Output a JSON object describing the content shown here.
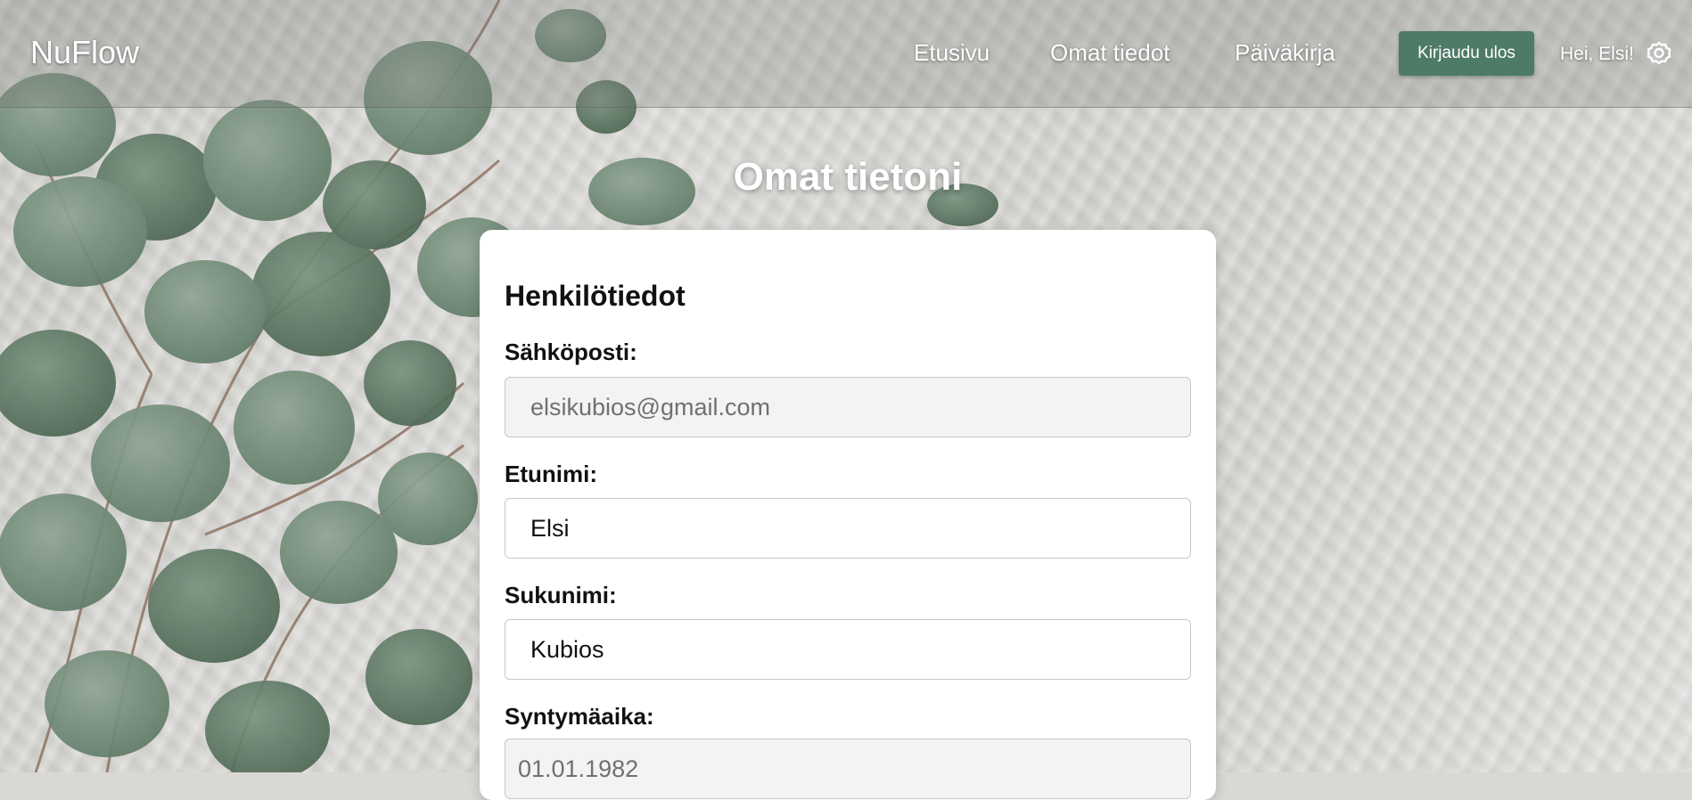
{
  "app": {
    "logo": "NuFlow"
  },
  "nav": {
    "items": [
      {
        "label": "Etusivu"
      },
      {
        "label": "Omat tiedot"
      },
      {
        "label": "Päiväkirja"
      }
    ],
    "logout_label": "Kirjaudu ulos",
    "greeting": "Hei, Elsi!",
    "settings_icon": "gear-icon"
  },
  "page": {
    "title": "Omat tietoni"
  },
  "form": {
    "section_title": "Henkilötiedot",
    "fields": [
      {
        "label": "Sähköposti:",
        "value": "elsikubios@gmail.com",
        "readonly": true
      },
      {
        "label": "Etunimi:",
        "value": "Elsi",
        "readonly": false
      },
      {
        "label": "Sukunimi:",
        "value": "Kubios",
        "readonly": false
      },
      {
        "label": "Syntymäaika:",
        "value": "01.01.1982",
        "readonly": true
      }
    ]
  },
  "colors": {
    "accent": "#4e7a68",
    "leaf": "#6f8b77"
  }
}
